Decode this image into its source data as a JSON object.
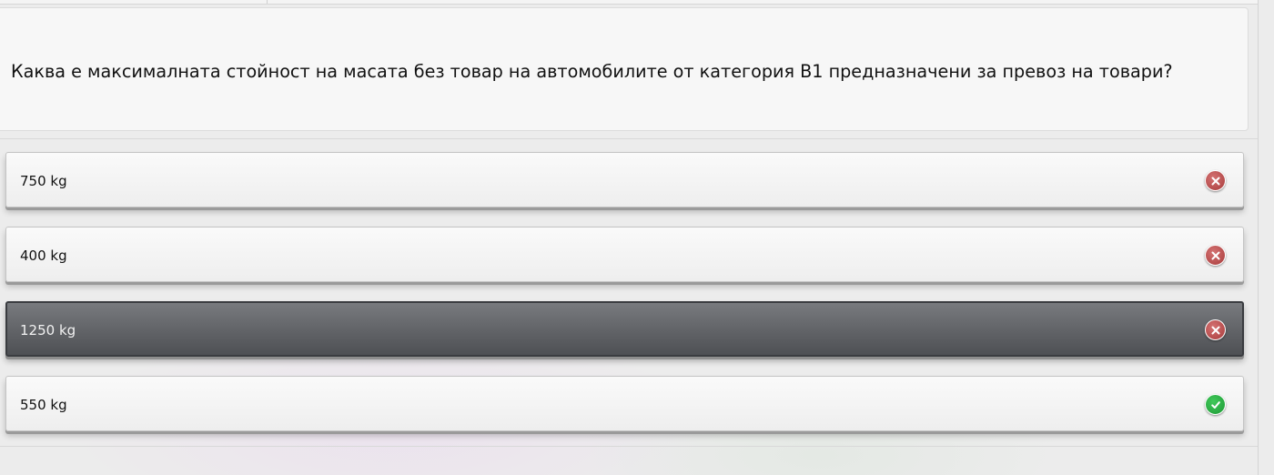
{
  "question": {
    "text": "Каква е максималната стойност на масата без товар на автомобилите от категория В1 предназначени за превоз на товари?"
  },
  "answers": [
    {
      "label": "750 kg",
      "status": "wrong",
      "icon": "x-circle-icon",
      "selected": false
    },
    {
      "label": "400 kg",
      "status": "wrong",
      "icon": "x-circle-icon",
      "selected": false
    },
    {
      "label": "1250 kg",
      "status": "wrong",
      "icon": "x-circle-icon",
      "selected": true
    },
    {
      "label": "550 kg",
      "status": "correct",
      "icon": "check-circle-icon",
      "selected": false
    }
  ],
  "colors": {
    "wrong": "#b84a4a",
    "correct": "#2aad45",
    "selected_bg": "#5e6064",
    "panel_bg": "#f7f7f7"
  }
}
